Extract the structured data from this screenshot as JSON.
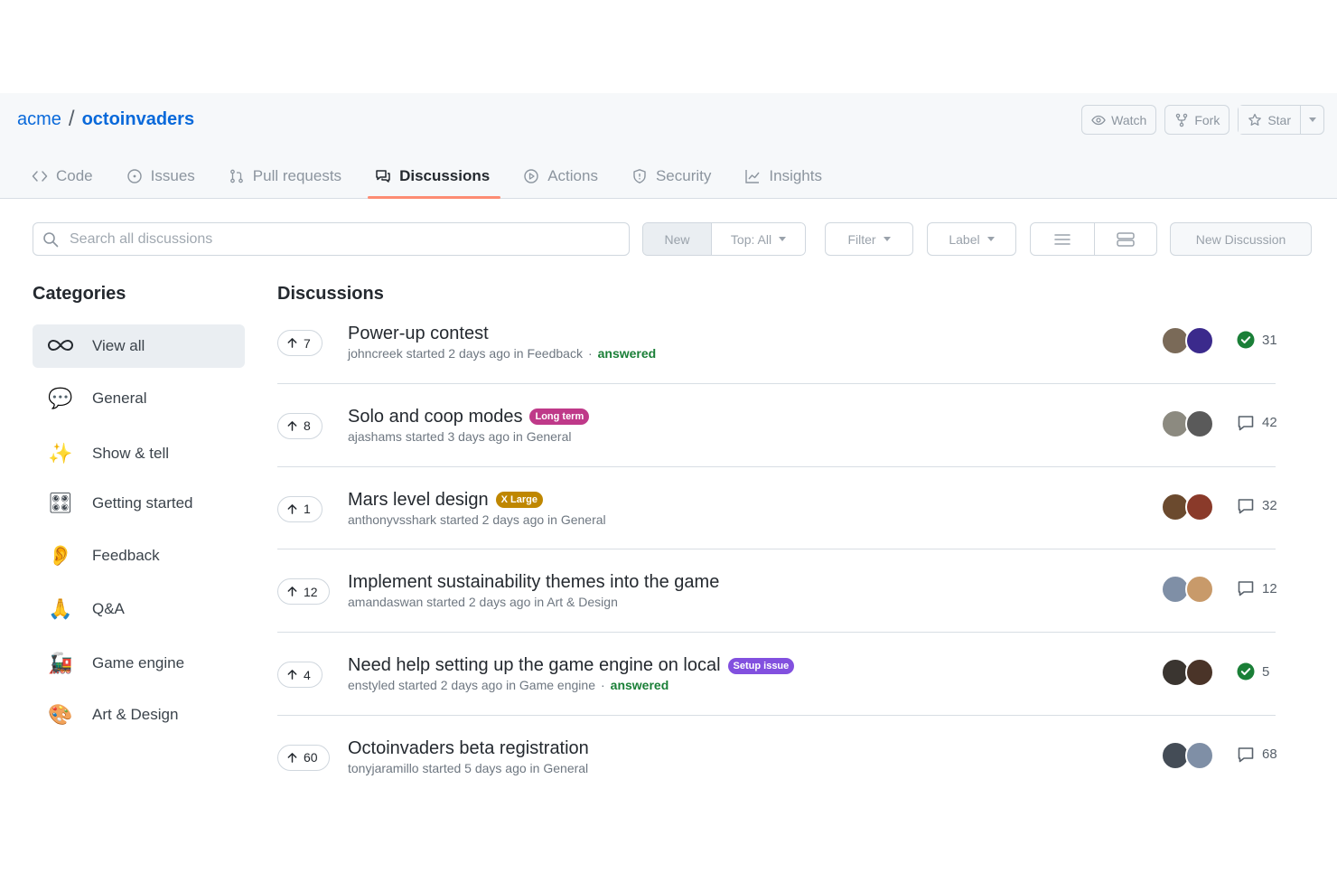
{
  "repo": {
    "owner": "acme",
    "separator": "/",
    "name": "octoinvaders"
  },
  "repo_actions": {
    "watch": "Watch",
    "fork": "Fork",
    "star": "Star"
  },
  "tabs": [
    {
      "label": "Code",
      "icon": "code-icon"
    },
    {
      "label": "Issues",
      "icon": "issue-icon"
    },
    {
      "label": "Pull requests",
      "icon": "pull-request-icon"
    },
    {
      "label": "Discussions",
      "icon": "discussion-icon",
      "active": true
    },
    {
      "label": "Actions",
      "icon": "play-icon"
    },
    {
      "label": "Security",
      "icon": "shield-icon"
    },
    {
      "label": "Insights",
      "icon": "graph-icon"
    }
  ],
  "search": {
    "placeholder": "Search all discussions"
  },
  "toolbar": {
    "sort_new": "New",
    "sort_top": "Top: All",
    "filter": "Filter",
    "label": "Label",
    "new_discussion": "New Discussion"
  },
  "sidebar": {
    "heading": "Categories",
    "items": [
      {
        "label": "View all",
        "icon": "infinity-icon",
        "active": true
      },
      {
        "label": "General",
        "emoji": "💬"
      },
      {
        "label": "Show & tell",
        "emoji": "✨"
      },
      {
        "label": "Getting started",
        "emoji": "🎛"
      },
      {
        "label": "Feedback",
        "emoji": "👂"
      },
      {
        "label": "Q&A",
        "emoji": "🙏"
      },
      {
        "label": "Game engine",
        "emoji": "🚂"
      },
      {
        "label": "Art & Design",
        "emoji": "🎨"
      }
    ]
  },
  "main": {
    "heading": "Discussions",
    "discussions": [
      {
        "votes": "7",
        "title": "Power-up contest",
        "label": "",
        "author": "johncreek",
        "started": "started 2 days ago in",
        "category": "Feedback",
        "answered": "answered",
        "stat": "31",
        "stat_type": "answered",
        "avatar_colors": [
          "#7a6a58",
          "#3b2a8c"
        ]
      },
      {
        "votes": "8",
        "title": "Solo and coop modes",
        "label": "Long term",
        "label_color": "#bf3989",
        "author": "ajashams",
        "started": "started 3 days ago in",
        "category": "General",
        "answered": "",
        "stat": "42",
        "stat_type": "comments",
        "avatar_colors": [
          "#8c8a80",
          "#5a5a5a"
        ]
      },
      {
        "votes": "1",
        "title": "Mars level design",
        "label": "X Large",
        "label_color": "#bf8700",
        "author": "anthonyvsshark",
        "started": "started 2 days ago in",
        "category": "General",
        "answered": "",
        "stat": "32",
        "stat_type": "comments",
        "avatar_colors": [
          "#6b4a2e",
          "#8a3a2a"
        ]
      },
      {
        "votes": "12",
        "title": "Implement sustainability themes into the game",
        "label": "",
        "author": "amandaswan",
        "started": "started 2 days ago in",
        "category": "Art & Design",
        "answered": "",
        "stat": "12",
        "stat_type": "comments",
        "avatar_colors": [
          "#7f8fa6",
          "#c89a6a"
        ]
      },
      {
        "votes": "4",
        "title": "Need help setting up the game engine on local",
        "label": "Setup issue",
        "label_color": "#8250df",
        "author": "enstyled",
        "started": "started 2 days ago in",
        "category": "Game engine",
        "answered": "answered",
        "stat": "5",
        "stat_type": "answered",
        "avatar_colors": [
          "#3a3530",
          "#4a3428"
        ]
      },
      {
        "votes": "60",
        "title": "Octoinvaders beta registration",
        "label": "",
        "author": "tonyjaramillo",
        "started": "started 5 days ago in",
        "category": "General",
        "answered": "",
        "stat": "68",
        "stat_type": "comments",
        "avatar_colors": [
          "#444c56",
          "#7f8fa6"
        ]
      }
    ]
  }
}
